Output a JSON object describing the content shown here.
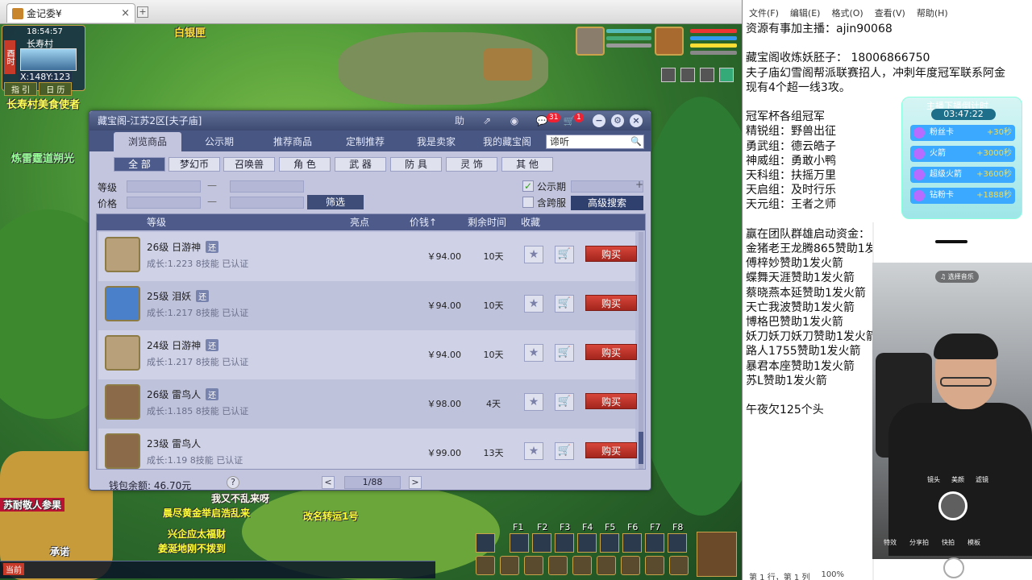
{
  "browser": {
    "tab_title": "金记委¥",
    "close": "×",
    "new_tab": "+"
  },
  "game": {
    "minimap": {
      "time": "18:54:57",
      "scene": "长寿村",
      "coord": "X:148Y:123",
      "btn_guide": "指 引",
      "btn_calendar": "日 历",
      "side": "酉时"
    },
    "npc_names": {
      "npc1": "白银匣",
      "npc2": "长寿村美食使者",
      "npc3": "炼雷霆道朔光",
      "npc4": "苏耐敬人参果",
      "npc5": "承诺",
      "npc6": "当前"
    },
    "chat_lines": [
      "我又不乱来呀",
      "晨尽黄金举启浩乱来",
      "改名转运1号",
      "兴企应太福财",
      "姜涎地刚不拨到"
    ],
    "skill_fkeys": [
      "F1",
      "F2",
      "F3",
      "F4",
      "F5",
      "F6",
      "F7",
      "F8"
    ]
  },
  "market": {
    "title": "藏宝阁-江苏2区[夫子庙]",
    "toolbar": {
      "help": "助",
      "share": "⇗",
      "record": "◉",
      "msg_icon": "💬",
      "msg_count": "31",
      "cart_icon": "🛒",
      "cart_count": "1",
      "minimize": "−",
      "settings": "⚙",
      "close": "×"
    },
    "tabs": [
      "浏览商品",
      "公示期",
      "推荐商品",
      "定制推荐",
      "我是卖家",
      "我的藏宝阁"
    ],
    "search_value": "谛听",
    "search_icon": "🔍",
    "categories": [
      "全 部",
      "梦幻币",
      "召唤兽",
      "角 色",
      "武 器",
      "防 具",
      "灵 饰",
      "其 他"
    ],
    "filters": {
      "level_label": "等级",
      "price_label": "价格",
      "dash": "—",
      "filter_button": "筛选",
      "public_label": "公示期",
      "cross_label": "含跨服",
      "advanced_button": "高级搜索",
      "plus": "+"
    },
    "headers": {
      "level": "等级",
      "highlight": "亮点",
      "price": "价钱↑",
      "remaining": "剩余时间",
      "fav": "收藏"
    },
    "rows": [
      {
        "level": "26级",
        "name": "日游神",
        "tag": "还",
        "growth": "成长:1.223 8技能 已认证",
        "price": "￥94.00",
        "days": "10天",
        "buy": "购买"
      },
      {
        "level": "25级",
        "name": "泪妖",
        "tag": "还",
        "growth": "成长:1.217 8技能 已认证",
        "price": "￥94.00",
        "days": "10天",
        "buy": "购买"
      },
      {
        "level": "24级",
        "name": "日游神",
        "tag": "还",
        "growth": "成长:1.217 8技能 已认证",
        "price": "￥94.00",
        "days": "10天",
        "buy": "购买"
      },
      {
        "level": "26级",
        "name": "雷鸟人",
        "tag": "还",
        "growth": "成长:1.185 8技能 已认证",
        "price": "￥98.00",
        "days": "4天",
        "buy": "购买"
      },
      {
        "level": "23级",
        "name": "雷鸟人",
        "tag": "",
        "growth": "成长:1.19 8技能 已认证",
        "price": "￥99.00",
        "days": "13天",
        "buy": "购买"
      }
    ],
    "icons": {
      "fav": "★",
      "cart": "🛒"
    },
    "wallet": "钱包余额:  46.70元",
    "help": "?",
    "page": "1/88",
    "prev": "<",
    "next": ">"
  },
  "notepad": {
    "menu": [
      "文件(F)",
      "编辑(E)",
      "格式(O)",
      "查看(V)",
      "帮助(H)"
    ],
    "text": "资源有事加主播：ajin90068\n\n藏宝阁收炼妖胚子： 18006866750\n夫子庙幻雪阁帮派联赛招人，冲刺年度冠军联系阿金\n现有4个超一线3攻。\n\n冠军杯各组冠军\n精锐组：野兽出征\n勇武组：德云皓子\n神威组：勇敢小鸭\n天科组：扶摇万里\n天启组：及时行乐\n天元组：王者之师\n\n赢在团队群雄启动资金：\n金猪老王龙腾865赞助1发\n傅梓妙赞助1发火箭\n蝶舞天涯赞助1发火箭\n蔡晓燕本延赞助1发火箭\n天亡我波赞助1发火箭\n博格巴赞助1发火箭\n妖刀妖刀妖刀赞助1发火箭\n路人1755赞助1发火箭\n暴君本座赞助1发火箭\n苏L赞助1发火箭\n\n午夜欠125个头",
    "status": [
      "第 1 行，第 1 列",
      "100%"
    ]
  },
  "reward": {
    "title": "主播下播倒计时",
    "timer": "03:47:22",
    "items": [
      {
        "name": "粉丝卡",
        "val": "+30秒"
      },
      {
        "name": "火箭",
        "val": "+3000秒"
      },
      {
        "name": "超级火箭",
        "val": "+3600秒"
      },
      {
        "name": "钻粉卡",
        "val": "+1888秒"
      }
    ]
  },
  "camera": {
    "chip": "♫ 选择音乐",
    "nav": [
      "特效",
      "分享拍",
      "快拍",
      "模板"
    ],
    "tools": [
      "镜头",
      "美颜",
      "滤镜"
    ]
  }
}
